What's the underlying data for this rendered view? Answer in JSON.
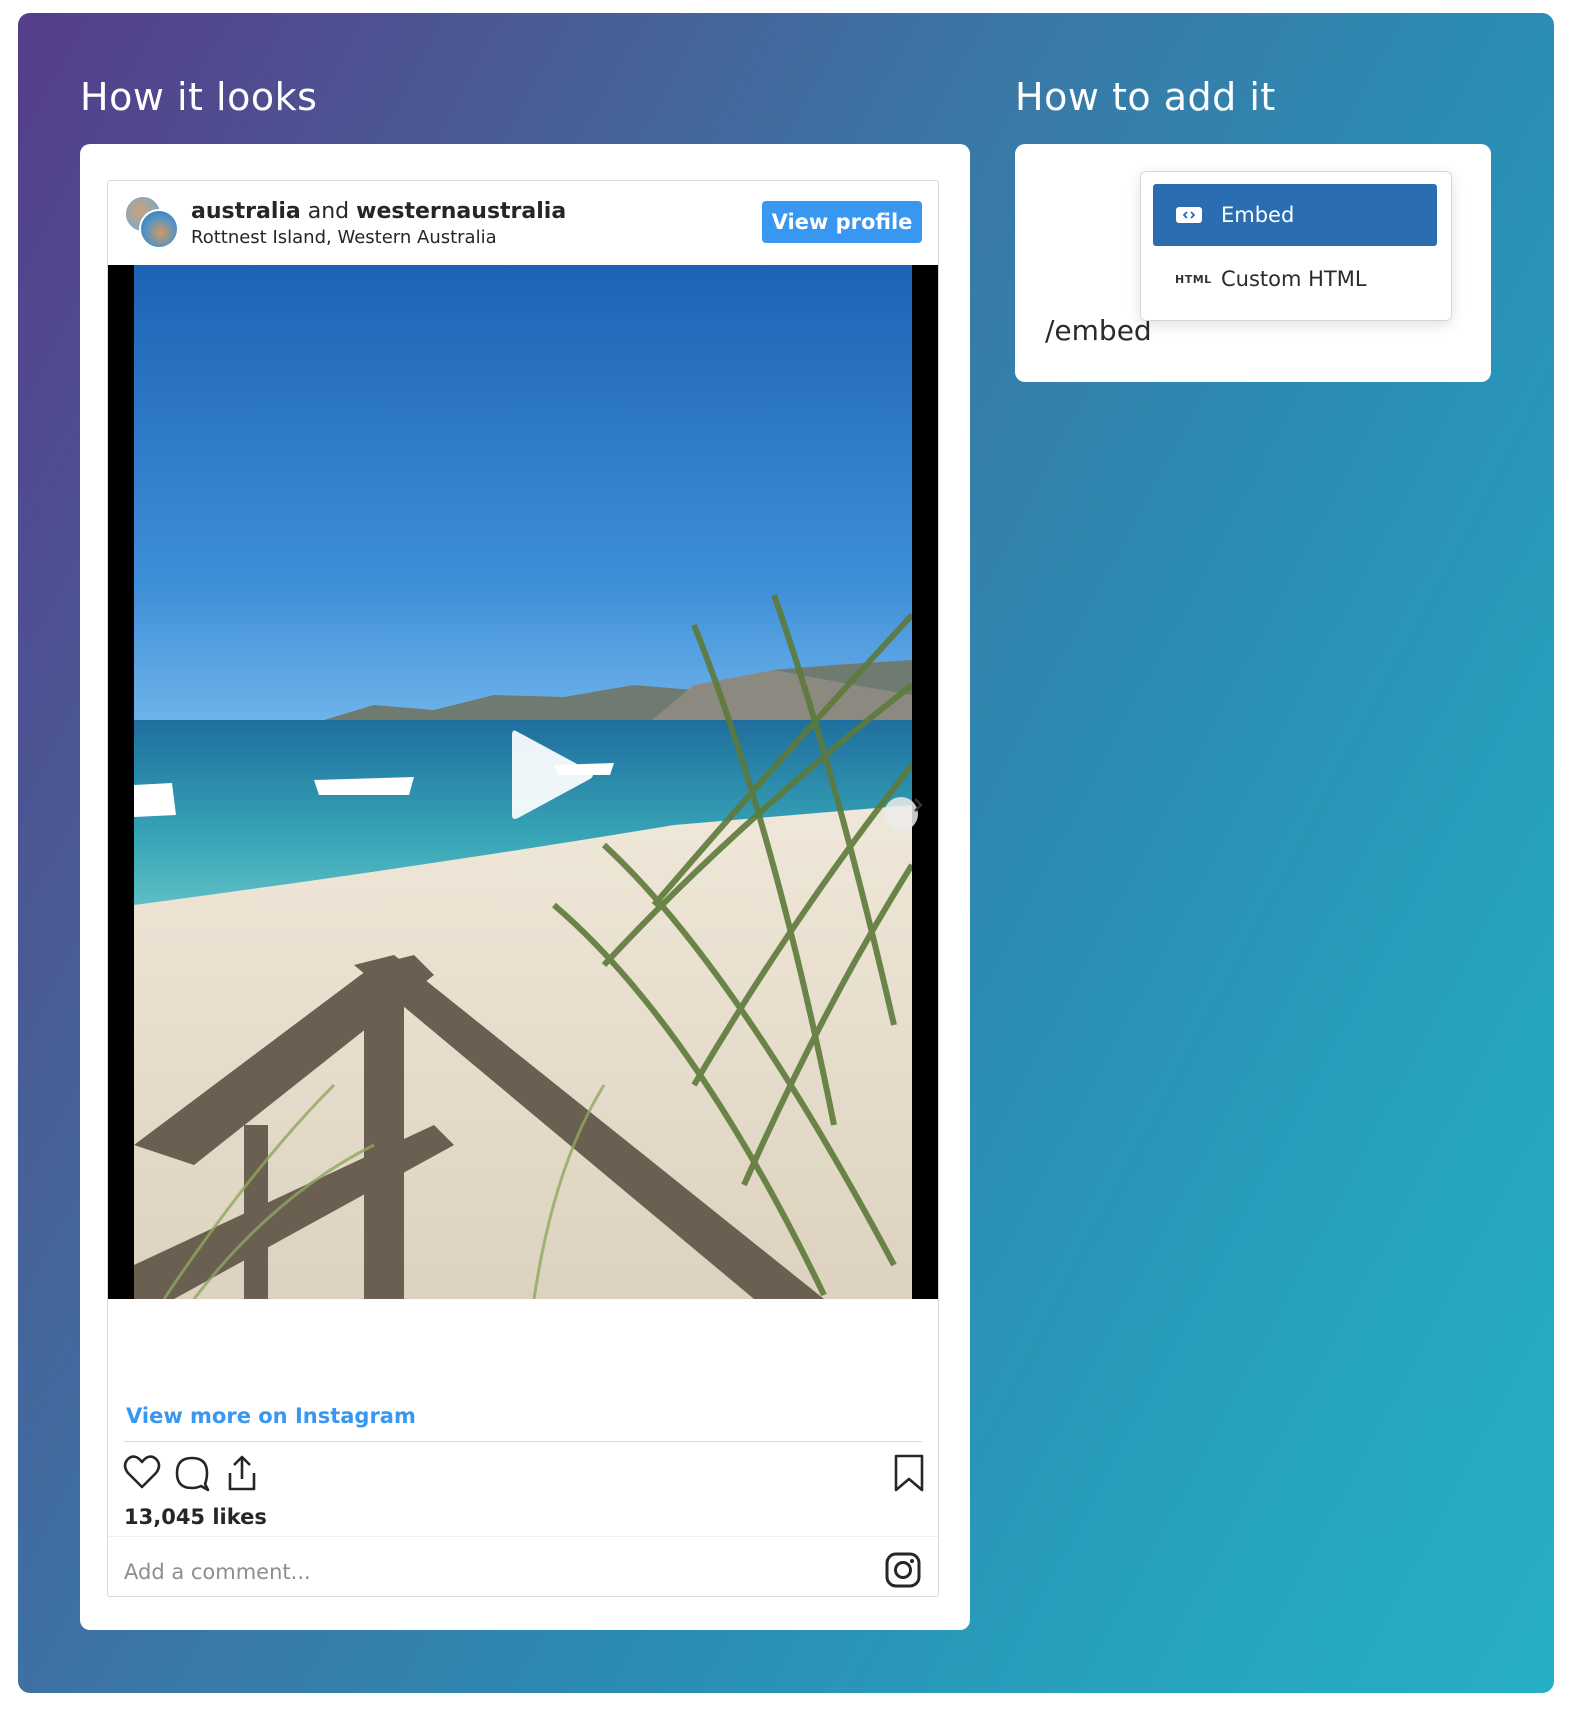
{
  "left_section": {
    "title": "How it looks",
    "instagram": {
      "account_primary": "australia",
      "joiner": "and",
      "account_secondary": "westernaustralia",
      "location": "Rottnest Island, Western Australia",
      "view_profile_label": "View profile",
      "view_more_label": "View more on Instagram",
      "likes": "13,045 likes",
      "comment_placeholder": "Add a comment..."
    }
  },
  "right_section": {
    "title": "How to add it",
    "command_text": "/embed",
    "menu_items": [
      {
        "label": "Embed",
        "icon": "embed-icon",
        "selected": true
      },
      {
        "label": "Custom HTML",
        "icon_text": "HTML",
        "selected": false
      }
    ]
  },
  "colors": {
    "accent_blue": "#3897f0",
    "menu_selected": "#2a6db0"
  }
}
